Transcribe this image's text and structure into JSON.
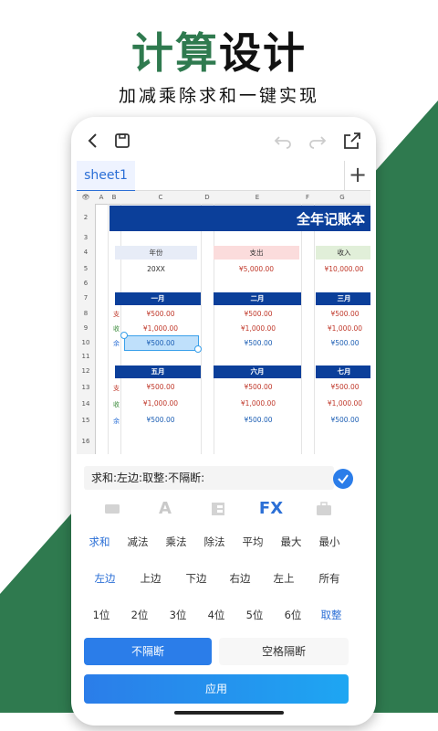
{
  "headline": {
    "part1": "计算",
    "part2": "设计"
  },
  "subline": "加减乘除求和一键实现",
  "app": {
    "sheet_tab": "sheet1",
    "grid": {
      "cols": [
        "A",
        "B",
        "C",
        "D",
        "E",
        "F",
        "G"
      ],
      "rows": [
        "2",
        "3",
        "4",
        "5",
        "6",
        "7",
        "8",
        "9",
        "10",
        "11",
        "12",
        "13",
        "14",
        "15",
        "16"
      ],
      "title": "全年记账本",
      "labels": {
        "year": "年份",
        "year_value": "20XX",
        "expense": "支出",
        "expense_value": "¥5,000.00",
        "income": "收入",
        "income_value": "¥10,000.00"
      },
      "months_top": [
        "一月",
        "二月",
        "三月"
      ],
      "months_bottom": [
        "五月",
        "六月",
        "七月"
      ],
      "row_marks": [
        "支",
        "收",
        "余"
      ],
      "values": [
        "¥500.00",
        "¥1,000.00",
        "¥500.00"
      ]
    },
    "formula_text": "求和:左边:取整:不隔断:",
    "toolbar_icons": {
      "keyboard": "keyboard-icon",
      "text": "A",
      "layout": "layout-icon",
      "fx": "FX",
      "briefcase": "briefcase-icon"
    },
    "func_row1": [
      "求和",
      "减法",
      "乘法",
      "除法",
      "平均",
      "最大",
      "最小"
    ],
    "func_row2": [
      "左边",
      "上边",
      "下边",
      "右边",
      "左上",
      "所有"
    ],
    "func_row3": [
      "1位",
      "2位",
      "3位",
      "4位",
      "5位",
      "6位",
      "取整"
    ],
    "segment": {
      "no_break": "不隔断",
      "space_break": "空格隔断"
    },
    "apply": "应用"
  },
  "colors": {
    "brand_green": "#2f7a4f",
    "accent_blue": "#2b6fd6",
    "banner_blue": "#0b3f9a"
  }
}
